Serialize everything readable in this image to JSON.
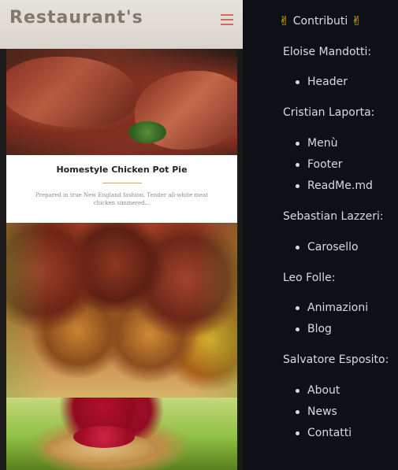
{
  "header": {
    "brand": "Restaurant's"
  },
  "card": {
    "title": "Homestyle Chicken Pot Pie",
    "text": "Prepared in true New England fashion. Tender all-white meat chicken simmered..."
  },
  "sidebar": {
    "title": "Contributi",
    "title_icon": "✌",
    "contributors": [
      {
        "name": "Eloise Mandotti:",
        "items": [
          "Header"
        ]
      },
      {
        "name": "Cristian Laporta:",
        "items": [
          "Menù",
          "Footer",
          "ReadMe.md"
        ]
      },
      {
        "name": "Sebastian Lazzeri:",
        "items": [
          "Carosello"
        ]
      },
      {
        "name": "Leo Folle:",
        "items": [
          "Animazioni",
          "Blog"
        ]
      },
      {
        "name": "Salvatore Esposito:",
        "items": [
          "About",
          "News",
          "Contatti"
        ]
      }
    ]
  }
}
